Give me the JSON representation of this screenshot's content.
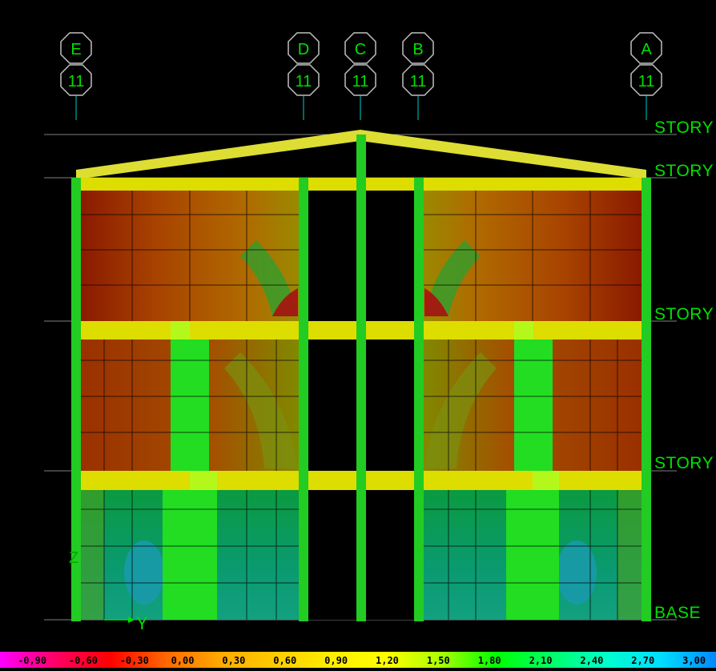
{
  "grid_bubbles": [
    {
      "letter": "E",
      "number": "11"
    },
    {
      "letter": "D",
      "number": "11"
    },
    {
      "letter": "C",
      "number": "11"
    },
    {
      "letter": "B",
      "number": "11"
    },
    {
      "letter": "A",
      "number": "11"
    }
  ],
  "story_labels": [
    "STORY",
    "STORY",
    "STORY",
    "STORY",
    "BASE"
  ],
  "axis": {
    "vertical": "Z",
    "horizontal": "Y"
  },
  "legend": {
    "values": [
      "-0,90",
      "-0,60",
      "-0,30",
      "0,00",
      "0,30",
      "0,60",
      "0,90",
      "1,20",
      "1,50",
      "1,80",
      "2,10",
      "2,40",
      "2,70",
      "3,00"
    ],
    "colors": [
      "#ff00ff",
      "#ff0066",
      "#ff0000",
      "#ff6600",
      "#ffaa00",
      "#ffcc00",
      "#ffee00",
      "#ffff00",
      "#aaff00",
      "#00ff00",
      "#00ff66",
      "#00ffcc",
      "#00ddff",
      "#0088ff"
    ]
  },
  "colors": {
    "frame_green": "#22cc22",
    "beam_yellow": "#dddd00",
    "grid_line": "#808080",
    "label_green": "#00e000"
  }
}
